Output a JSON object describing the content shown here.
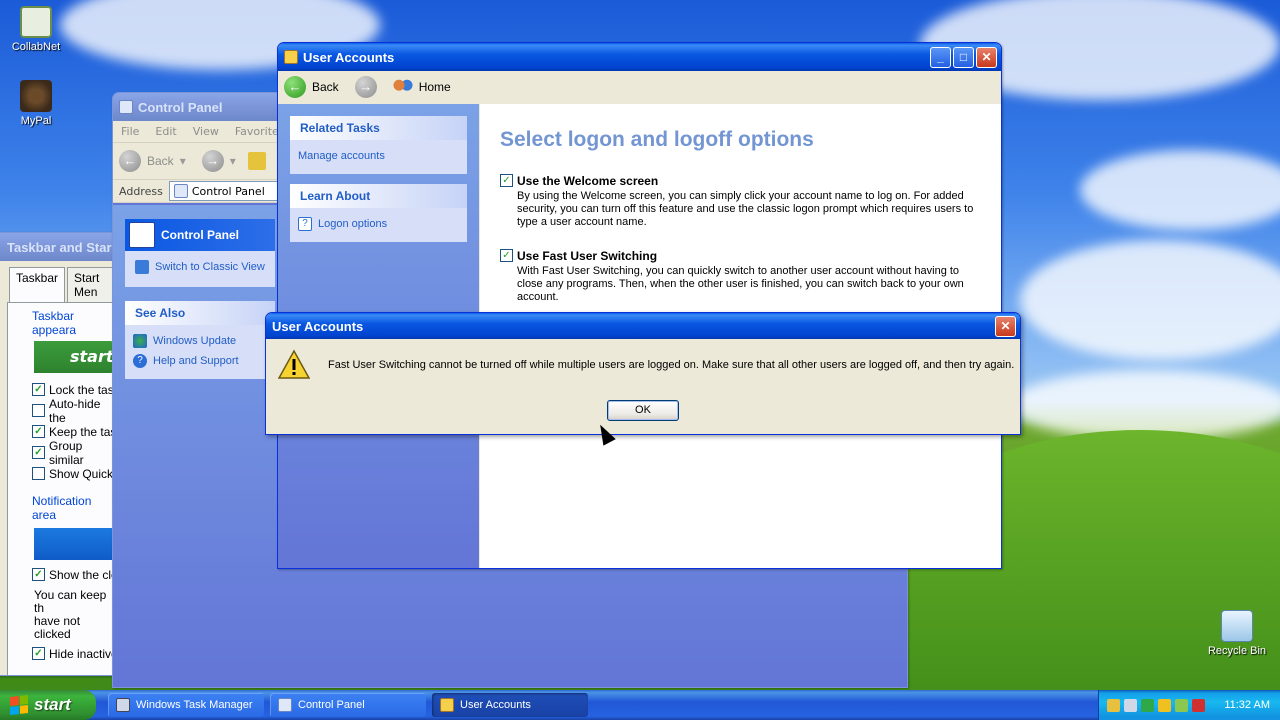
{
  "desktop": {
    "icons": [
      {
        "label": "CollabNet",
        "icon": "collabnet-icon"
      },
      {
        "label": "MyPal",
        "icon": "mypal-icon"
      },
      {
        "label": "Recycle Bin",
        "icon": "recycle-bin-icon"
      }
    ]
  },
  "taskbar_properties": {
    "title": "Taskbar and Star",
    "tabs": [
      "Taskbar",
      "Start Men"
    ],
    "group_appearance": "Taskbar appeara",
    "start_preview": "start",
    "options": [
      {
        "label": "Lock the tas",
        "checked": true
      },
      {
        "label": "Auto-hide the",
        "checked": false
      },
      {
        "label": "Keep the tas",
        "checked": true
      },
      {
        "label": "Group similar",
        "checked": true
      },
      {
        "label": "Show Quick",
        "checked": false
      }
    ],
    "group_notification": "Notification area",
    "notification_options": [
      {
        "label": "Show the clc",
        "checked": true
      }
    ],
    "note_line1": "You can keep th",
    "note_line2": "have not clicked",
    "hide_inactive": {
      "label": "Hide inactive",
      "checked": true
    }
  },
  "control_panel": {
    "title": "Control Panel",
    "menu": [
      "File",
      "Edit",
      "View",
      "Favorites"
    ],
    "back_label": "Back",
    "address_label": "Address",
    "address_value": "Control Panel",
    "header_panel": "Control Panel",
    "switch_link": "Switch to Classic View",
    "see_also_title": "See Also",
    "see_also_links": [
      "Windows Update",
      "Help and Support"
    ]
  },
  "user_accounts": {
    "title": "User Accounts",
    "back_label": "Back",
    "home_label": "Home",
    "related_tasks_title": "Related Tasks",
    "related_tasks_link": "Manage accounts",
    "learn_about_title": "Learn About",
    "learn_about_link": "Logon options",
    "heading": "Select logon and logoff options",
    "options": [
      {
        "title": "Use the Welcome screen",
        "checked": true,
        "desc1": "By using the Welcome screen, you can simply click your account name to log on. For added",
        "desc2": "security, you can turn off this feature and use the classic logon prompt which requires users to",
        "desc3": "type a user account name."
      },
      {
        "title": "Use Fast User Switching",
        "checked": true,
        "desc1": "With Fast User Switching, you can quickly switch to another user account without having to",
        "desc2": "close any programs. Then, when the other user is finished, you can switch back to your own",
        "desc3": "account."
      }
    ]
  },
  "dialog": {
    "title": "User Accounts",
    "message": "Fast User Switching cannot be turned off while multiple users are logged on. Make sure that all other users are logged off, and then try again.",
    "ok_label": "OK"
  },
  "taskbar": {
    "start_label": "start",
    "tasks": [
      {
        "label": "Windows Task Manager",
        "active": false
      },
      {
        "label": "Control Panel",
        "active": false
      },
      {
        "label": "User Accounts",
        "active": true
      }
    ],
    "clock": "11:32 AM"
  },
  "colors": {
    "title_active": "#0a58e2",
    "link_blue": "#215dc6",
    "heading_blue": "#7396d3",
    "start_green": "#3cb43c"
  }
}
